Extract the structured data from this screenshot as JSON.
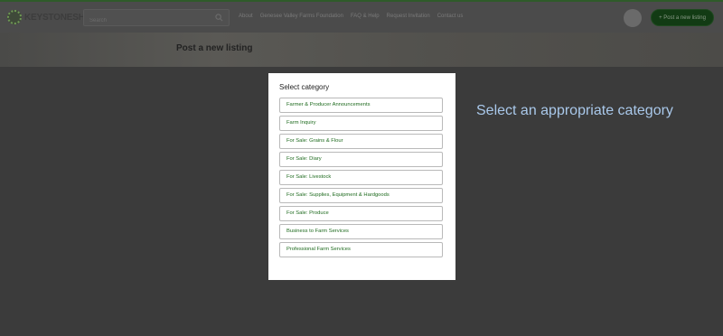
{
  "header": {
    "logo_text": "KEYSTONESHARE",
    "search_placeholder": "Search",
    "nav": [
      "About",
      "Genesee Valley Farms Foundation",
      "FAQ & Help",
      "Request Invitation",
      "Contact us"
    ],
    "post_button": "+ Post a new listing"
  },
  "page": {
    "title": "Post a new listing"
  },
  "modal": {
    "title": "Select category",
    "categories": [
      "Farmer & Producer Announcements",
      "Farm Inquiry",
      "For Sale: Grains & Flour",
      "For Sale: Diary",
      "For Sale: Livestock",
      "For Sale: Supplies, Equipment & Hardgoods",
      "For Sale: Produce",
      "Business to Farm Services",
      "Professional Farm Services"
    ]
  },
  "hint": {
    "text": "Select an appropriate category"
  },
  "colors": {
    "accent": "#1f6b1f",
    "overlay": "#3b3b3b",
    "hint": "#a9c8ea"
  }
}
